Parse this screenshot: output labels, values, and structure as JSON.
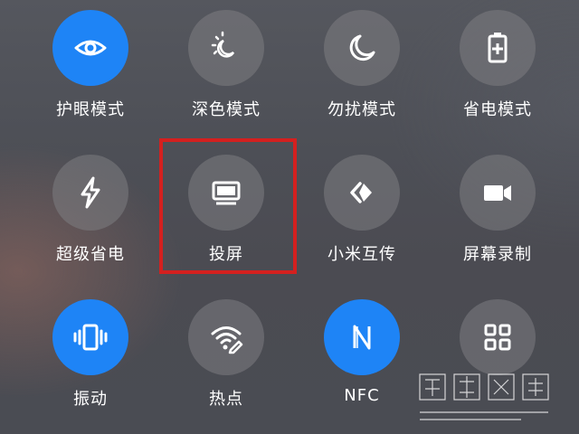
{
  "tiles": [
    {
      "label": "护眼模式",
      "icon": "eye-icon",
      "active": true
    },
    {
      "label": "深色模式",
      "icon": "sun-moon-icon",
      "active": false
    },
    {
      "label": "勿扰模式",
      "icon": "moon-icon",
      "active": false
    },
    {
      "label": "省电模式",
      "icon": "battery-plus-icon",
      "active": false
    },
    {
      "label": "超级省电",
      "icon": "lightning-icon",
      "active": false
    },
    {
      "label": "投屏",
      "icon": "monitor-icon",
      "active": false
    },
    {
      "label": "小米互传",
      "icon": "share-arrows-icon",
      "active": false
    },
    {
      "label": "屏幕录制",
      "icon": "video-camera-icon",
      "active": false
    },
    {
      "label": "振动",
      "icon": "vibrate-icon",
      "active": true
    },
    {
      "label": "热点",
      "icon": "wifi-hotspot-icon",
      "active": false
    },
    {
      "label": "NFC",
      "icon": "nfc-icon",
      "active": true
    },
    {
      "label": "",
      "icon": "grid-icon",
      "active": false
    }
  ],
  "colors": {
    "active": "#1e84f6",
    "inactive": "rgba(125,125,130,0.55)",
    "highlight": "#d4201f",
    "label": "#ffffff"
  }
}
